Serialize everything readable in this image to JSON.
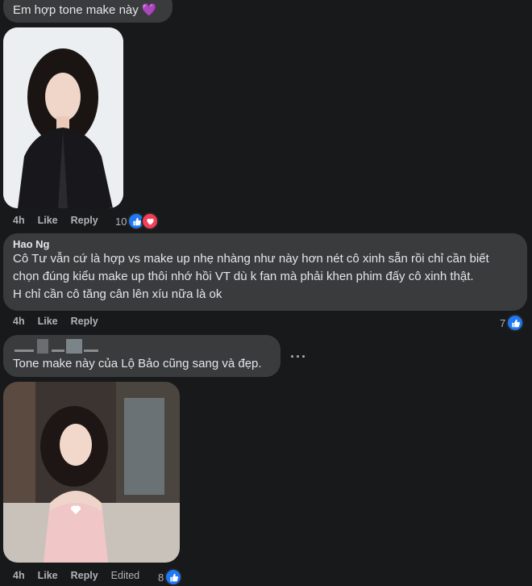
{
  "comments": [
    {
      "text": "Em hợp tone make này 💜",
      "time": "4h",
      "like_label": "Like",
      "reply_label": "Reply",
      "reaction_count": "10",
      "reactions": [
        "like-icon",
        "love-icon"
      ]
    },
    {
      "author": "Hao Ng",
      "text_lines": [
        "Cô Tư vẫn cứ là hợp vs make up nhẹ nhàng như này hơn nét cô xinh sẵn rồi chỉ cần biết",
        "chọn đúng kiểu make up thôi nhớ hồi VT dù k fan mà phải khen phim đấy cô xinh thật.",
        "H chỉ cần cô tăng cân lên xíu nữa là ok"
      ],
      "time": "4h",
      "like_label": "Like",
      "reply_label": "Reply",
      "reaction_count": "7",
      "reactions": [
        "like-icon"
      ]
    },
    {
      "text": "Tone make này của Lộ Bảo cũng sang và đẹp.",
      "time": "4h",
      "like_label": "Like",
      "reply_label": "Reply",
      "edited_label": "Edited",
      "reaction_count": "8",
      "reactions": [
        "like-icon"
      ]
    }
  ],
  "more_glyph": "···",
  "colors": {
    "background": "#18191a",
    "bubble": "#3a3b3c",
    "text": "#e4e6eb",
    "secondary": "#b0b3b8",
    "like": "#2078f4",
    "love": "#f33e58"
  }
}
